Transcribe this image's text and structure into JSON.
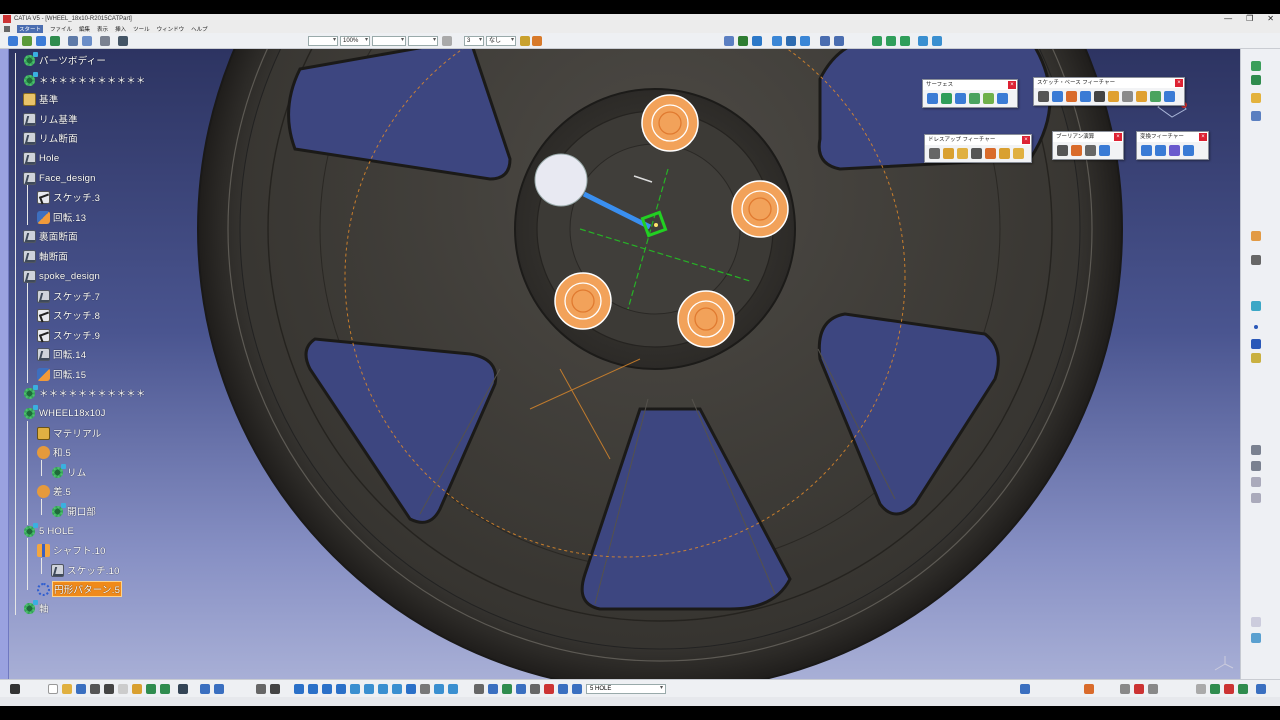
{
  "window": {
    "title": "CATIA V5 - [WHEEL_18x10-R2015CATPart]",
    "controls": [
      "—",
      "❐",
      "✕"
    ]
  },
  "menu": {
    "items": [
      "スタート",
      "ファイル",
      "編集",
      "表示",
      "挿入",
      "ツール",
      "ウィンドウ",
      "ヘルプ"
    ]
  },
  "toolbar_top": {
    "zoom_combo": "100%",
    "layer_combo": "3",
    "filter_combo": "なし"
  },
  "tree": {
    "nodes": [
      {
        "label": "パーツボディー",
        "icon": "gear-icon"
      },
      {
        "label": "＊＊＊＊＊＊＊＊＊＊＊",
        "icon": "gear-icon"
      },
      {
        "label": "基準",
        "icon": "datum-icon"
      },
      {
        "label": "リム基準",
        "icon": "sketch-box-icon"
      },
      {
        "label": "リム断面",
        "icon": "sketch-box-icon"
      },
      {
        "label": "Hole",
        "icon": "sketch-box-icon"
      },
      {
        "label": "Face_design",
        "icon": "sketch-box-icon"
      },
      {
        "label": "スケッチ.3",
        "icon": "sketch-icon"
      },
      {
        "label": "回転.13",
        "icon": "revolve-icon"
      },
      {
        "label": "裏面断面",
        "icon": "sketch-box-icon"
      },
      {
        "label": "軸断面",
        "icon": "sketch-box-icon"
      },
      {
        "label": "spoke_design",
        "icon": "sketch-box-icon"
      },
      {
        "label": "スケッチ.7",
        "icon": "sketch-box-icon"
      },
      {
        "label": "スケッチ.8",
        "icon": "sketch-icon"
      },
      {
        "label": "スケッチ.9",
        "icon": "sketch-icon"
      },
      {
        "label": "回転.14",
        "icon": "revolve-icon"
      },
      {
        "label": "回転.15",
        "icon": "revolve-icon"
      },
      {
        "label": "＊＊＊＊＊＊＊＊＊＊＊",
        "icon": "gear-icon"
      },
      {
        "label": "WHEEL18x10J",
        "icon": "gear-icon"
      },
      {
        "label": "マテリアル",
        "icon": "material-icon"
      },
      {
        "label": "和.5",
        "icon": "boolean-icon"
      },
      {
        "label": "リム",
        "icon": "gear-icon"
      },
      {
        "label": "差.5",
        "icon": "boolean-icon"
      },
      {
        "label": "開口部",
        "icon": "gear-icon"
      },
      {
        "label": "5 HOLE",
        "icon": "gear-icon"
      },
      {
        "label": "シャフト.10",
        "icon": "shaft-icon"
      },
      {
        "label": "スケッチ.10",
        "icon": "sketch-box-icon"
      },
      {
        "label": "円形パターン.5",
        "icon": "pattern-icon",
        "highlighted": true
      },
      {
        "label": "軸",
        "icon": "gear-icon"
      }
    ]
  },
  "floating_toolbars": [
    {
      "title": "サーフェス"
    },
    {
      "title": "スケッチ・ベース フィーチャー"
    },
    {
      "title": "ドレスアップ フィーチャー"
    },
    {
      "title": "ブーリアン演算"
    },
    {
      "title": "変換フィーチャー"
    }
  ],
  "toolbar_bottom": {
    "current_body_combo": "5 HOLE"
  },
  "colors": {
    "viewport_top": "#2d3462",
    "viewport_bottom": "#a8afd6",
    "tree_highlight": "#f08a1a",
    "wheel": "#3b3936",
    "bolt": "#f2a25a",
    "accent_green": "#22d022"
  }
}
